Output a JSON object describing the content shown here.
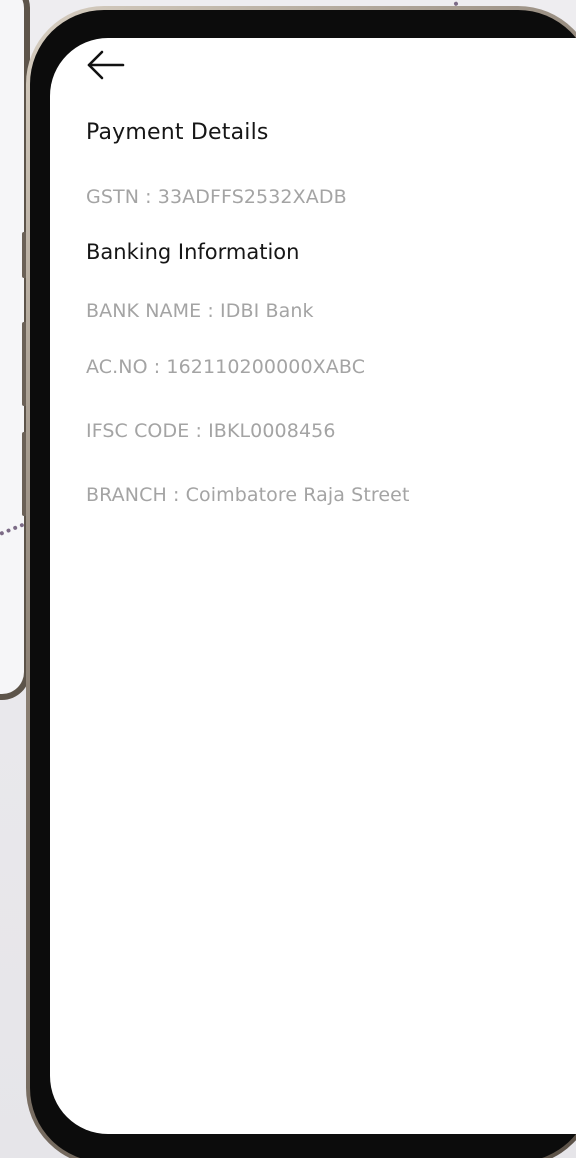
{
  "page": {
    "title": "Payment Details",
    "gstn": "GSTN : 33ADFFS2532XADB",
    "banking_title": "Banking Information",
    "bank_name": "BANK NAME  : IDBI Bank",
    "account_no": "AC.NO : 162110200000XABC",
    "ifsc": "IFSC CODE : IBKL0008456",
    "branch": "BRANCH : Coimbatore Raja Street"
  },
  "icons": {
    "back": "back-arrow-icon"
  },
  "colors": {
    "background": "#e9e8ec",
    "screen": "#ffffff",
    "heading_text": "#161616",
    "detail_text": "#a4a4a4",
    "device_frame": "#0c0c0c"
  }
}
